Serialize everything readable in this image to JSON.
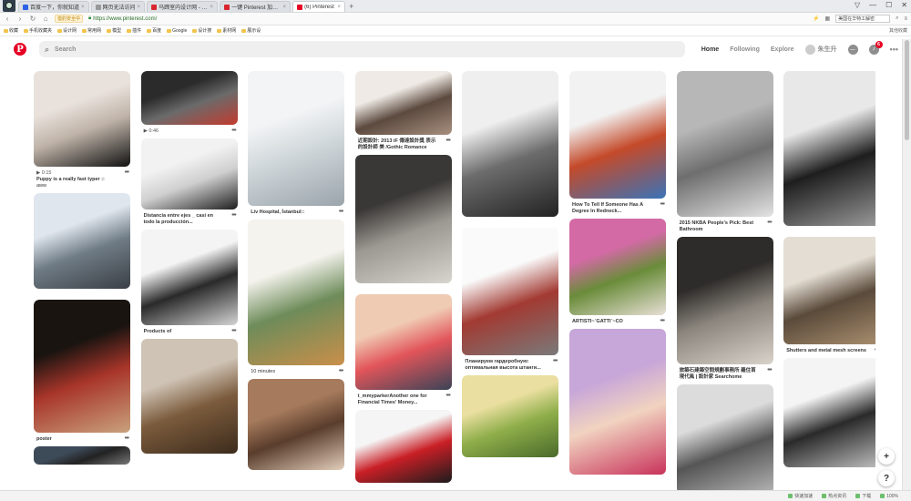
{
  "browser": {
    "tabs": [
      {
        "label": "百度一下，你就知道",
        "favicon_color": "#2d62e6",
        "active": false
      },
      {
        "label": "网页无法访问",
        "favicon_color": "#999999",
        "active": false
      },
      {
        "label": "马蹄室内设计网 - 马蹄网",
        "favicon_color": "#d9262e",
        "active": false
      },
      {
        "label": "一键 Pinterest 加载，设置更新",
        "favicon_color": "#d9262e",
        "active": false
      },
      {
        "label": "(6) Pinterest",
        "favicon_color": "#e60023",
        "active": true
      }
    ],
    "new_tab": "+",
    "safe_badge": "猎豹安全中",
    "url": "https://www.pinterest.com/",
    "address_search": "美国在华特工解密",
    "bookmarks": [
      "收藏",
      "手机收藏夹",
      "设计网",
      "常用网",
      "模型",
      "插件",
      "百度",
      "Google",
      "设计搜",
      "素材网",
      "展示设"
    ],
    "bookmarks_right": "其他收藏"
  },
  "header": {
    "logo": "P",
    "search_placeholder": "Search",
    "nav": {
      "home": "Home",
      "following": "Following",
      "explore": "Explore",
      "user": "朱生升"
    },
    "notification_count": "6"
  },
  "columns": [
    [
      {
        "h": 105,
        "colors": [
          "#e9e2dc",
          "#bfb3a8",
          "#111111"
        ],
        "title": "Puppy is a really fast typer ::",
        "sub": "aww",
        "dur": "0:15"
      },
      {
        "h": 105,
        "colors": [
          "#dfe6ee",
          "#6f7b85",
          "#3a3f45"
        ]
      },
      {
        "h": 146,
        "colors": [
          "#1a1410",
          "#a8352a",
          "#c9a27c"
        ],
        "title": "poster"
      },
      {
        "h": 20,
        "colors": [
          "#3d4a58",
          "#222222",
          "#777777"
        ]
      }
    ],
    [
      {
        "h": 59,
        "colors": [
          "#2b2b2b",
          "#6b6b6b",
          "#c23a2e"
        ],
        "dur": "0:46"
      },
      {
        "h": 78,
        "colors": [
          "#f2f2f2",
          "#cfcfcf",
          "#1e1e1e"
        ],
        "title": "Distancia entre ejes _ casi en todo la producción..."
      },
      {
        "h": 105,
        "colors": [
          "#f4f4f4",
          "#2a2a2a",
          "#d4d4d4"
        ],
        "title": "Products of"
      },
      {
        "h": 126,
        "colors": [
          "#cfc3b5",
          "#7b5b3c",
          "#3c2b1c"
        ]
      }
    ],
    [
      {
        "h": 148,
        "colors": [
          "#f2f4f5",
          "#cfd6da",
          "#9aa4aa"
        ],
        "title": "Liv Hospital, İstanbul::"
      },
      {
        "h": 160,
        "colors": [
          "#f5f3ee",
          "#6e8c5a",
          "#c98f4a"
        ],
        "title": "10 minutes",
        "plain": true
      },
      {
        "h": 100,
        "colors": [
          "#a67a5c",
          "#5a3d2c",
          "#e2cdbb"
        ]
      }
    ],
    [
      {
        "h": 70,
        "colors": [
          "#efeae5",
          "#5c4a3f",
          "#a89080"
        ],
        "title": "近期設計: 2013 iF 傳達設計獎 表示的設計師 美 /Gothic Romance"
      },
      {
        "h": 141,
        "colors": [
          "#3a3836",
          "#9b9791",
          "#d8d5cf"
        ]
      },
      {
        "h": 105,
        "colors": [
          "#f0cbb4",
          "#e2555a",
          "#3a4356"
        ],
        "title": "t_mmyparkerAnother one for Financial Times' Money..."
      },
      {
        "h": 80,
        "colors": [
          "#f5f5f5",
          "#c91f26",
          "#1c1c1c"
        ]
      }
    ],
    [
      {
        "h": 160,
        "colors": [
          "#efefef",
          "#6c6c6c",
          "#222222"
        ]
      },
      {
        "h": 140,
        "colors": [
          "#fafafa",
          "#a23a32",
          "#7a7a7a"
        ],
        "title": "Планируем гардеробную: оптимальная высота штанги..."
      },
      {
        "h": 90,
        "colors": [
          "#eadfa0",
          "#8fae4a",
          "#4a6a2a"
        ]
      }
    ],
    [
      {
        "h": 140,
        "colors": [
          "#f2f2f2",
          "#c44a2a",
          "#3a73b8"
        ],
        "title": "How To Tell If Someone Has A Degree In Redneck..."
      },
      {
        "h": 106,
        "colors": [
          "#d36aa5",
          "#6a8c3a",
          "#e8e0d6"
        ],
        "title": "ARTISTI~`GATTI`~CO"
      },
      {
        "h": 160,
        "colors": [
          "#c7a6d9",
          "#f1d3c0",
          "#c8325a"
        ]
      }
    ],
    [
      {
        "h": 160,
        "colors": [
          "#b7b7b7",
          "#6e6e6e",
          "#e3e3e3"
        ],
        "title": "2015 NKBA People's Pick: Best Bathroom"
      },
      {
        "h": 140,
        "colors": [
          "#2e2c2a",
          "#8b857d",
          "#d9d3cc"
        ],
        "title": "旅築石建築空間規劃事務所 羅住首 現代風 | 設計家 Searchome"
      },
      {
        "h": 120,
        "colors": [
          "#dcdcdc",
          "#555555",
          "#b5b5b5"
        ]
      }
    ],
    [
      {
        "h": 170,
        "colors": [
          "#e8e8e8",
          "#1e1e1e",
          "#9a9a9a"
        ]
      },
      {
        "h": 118,
        "colors": [
          "#e3ddd3",
          "#5a4a3a",
          "#a88e6e"
        ],
        "title": "Shutters and metal mesh screens"
      },
      {
        "h": 120,
        "colors": [
          "#f4f4f4",
          "#2a2a2a",
          "#bdbdbd"
        ]
      }
    ]
  ],
  "fab": {
    "plus": "+",
    "help": "?"
  },
  "status_bar": [
    "快速加速",
    "热点资讯",
    "下载",
    "100%"
  ]
}
